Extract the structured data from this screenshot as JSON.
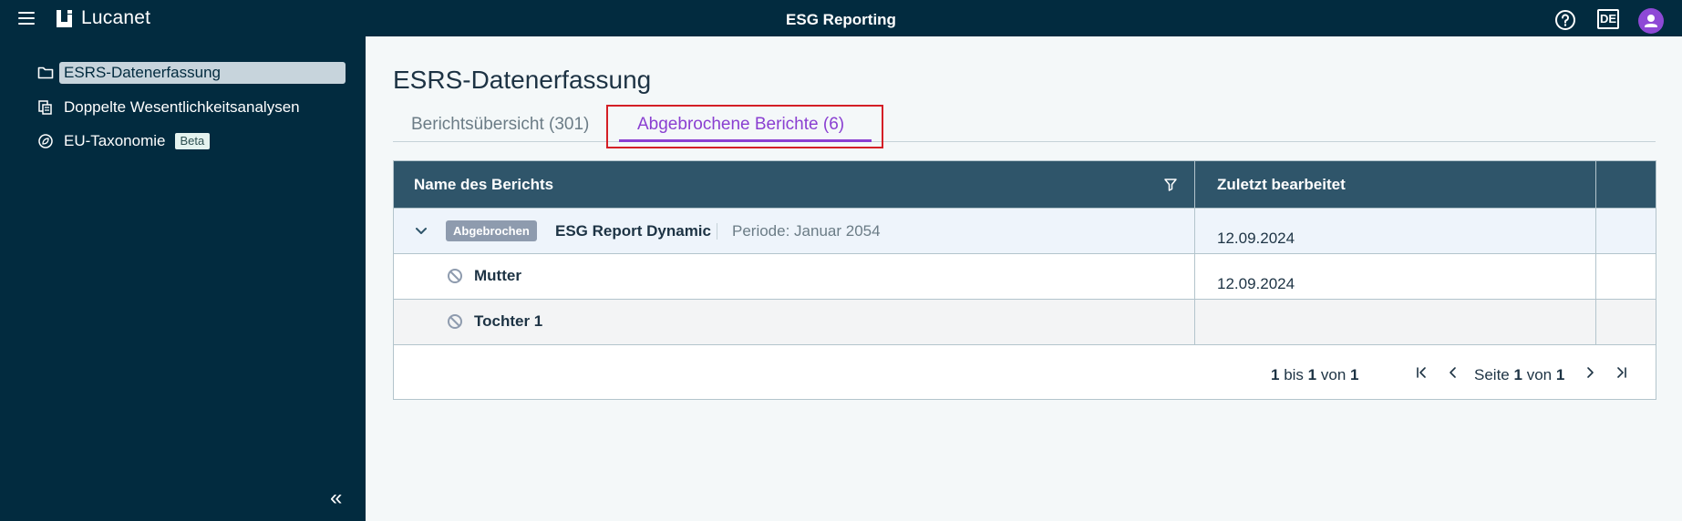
{
  "app": {
    "logo_text": "Lucanet",
    "title": "ESG Reporting",
    "language": "DE"
  },
  "sidebar": {
    "items": [
      {
        "label": "ESRS-Datenerfassung",
        "icon": "folder-icon",
        "active": true
      },
      {
        "label": "Doppelte Wesentlichkeitsanalysen",
        "icon": "copy-document-icon"
      },
      {
        "label": "EU-Taxonomie",
        "icon": "globe-leaf-icon",
        "badge": "Beta"
      }
    ],
    "collapse_label": "«"
  },
  "main": {
    "title": "ESRS-Datenerfassung",
    "tabs": [
      {
        "label": "Berichtsübersicht (301)"
      },
      {
        "label": "Abgebrochene Berichte (6)",
        "selected": true
      }
    ]
  },
  "table": {
    "columns": [
      "Name des Berichts",
      "Zuletzt bearbeitet"
    ],
    "group": {
      "status": "Abgebrochen",
      "name": "ESG Report Dynamic",
      "period": "Periode: Januar 2054",
      "date": "12.09.2024"
    },
    "children": [
      {
        "name": "Mutter",
        "date": "12.09.2024"
      },
      {
        "name": "Tochter 1",
        "date": ""
      }
    ],
    "footer": {
      "from": "1",
      "bis": "bis",
      "to": "1",
      "von": "von",
      "total": "1",
      "page_label": "Seite",
      "page": "1",
      "page_von": "von",
      "page_total": "1"
    }
  },
  "colors": {
    "topbar": "#022b3f",
    "accent": "#8a3fd1",
    "header": "#2f556a",
    "highlight": "#d41f26"
  }
}
